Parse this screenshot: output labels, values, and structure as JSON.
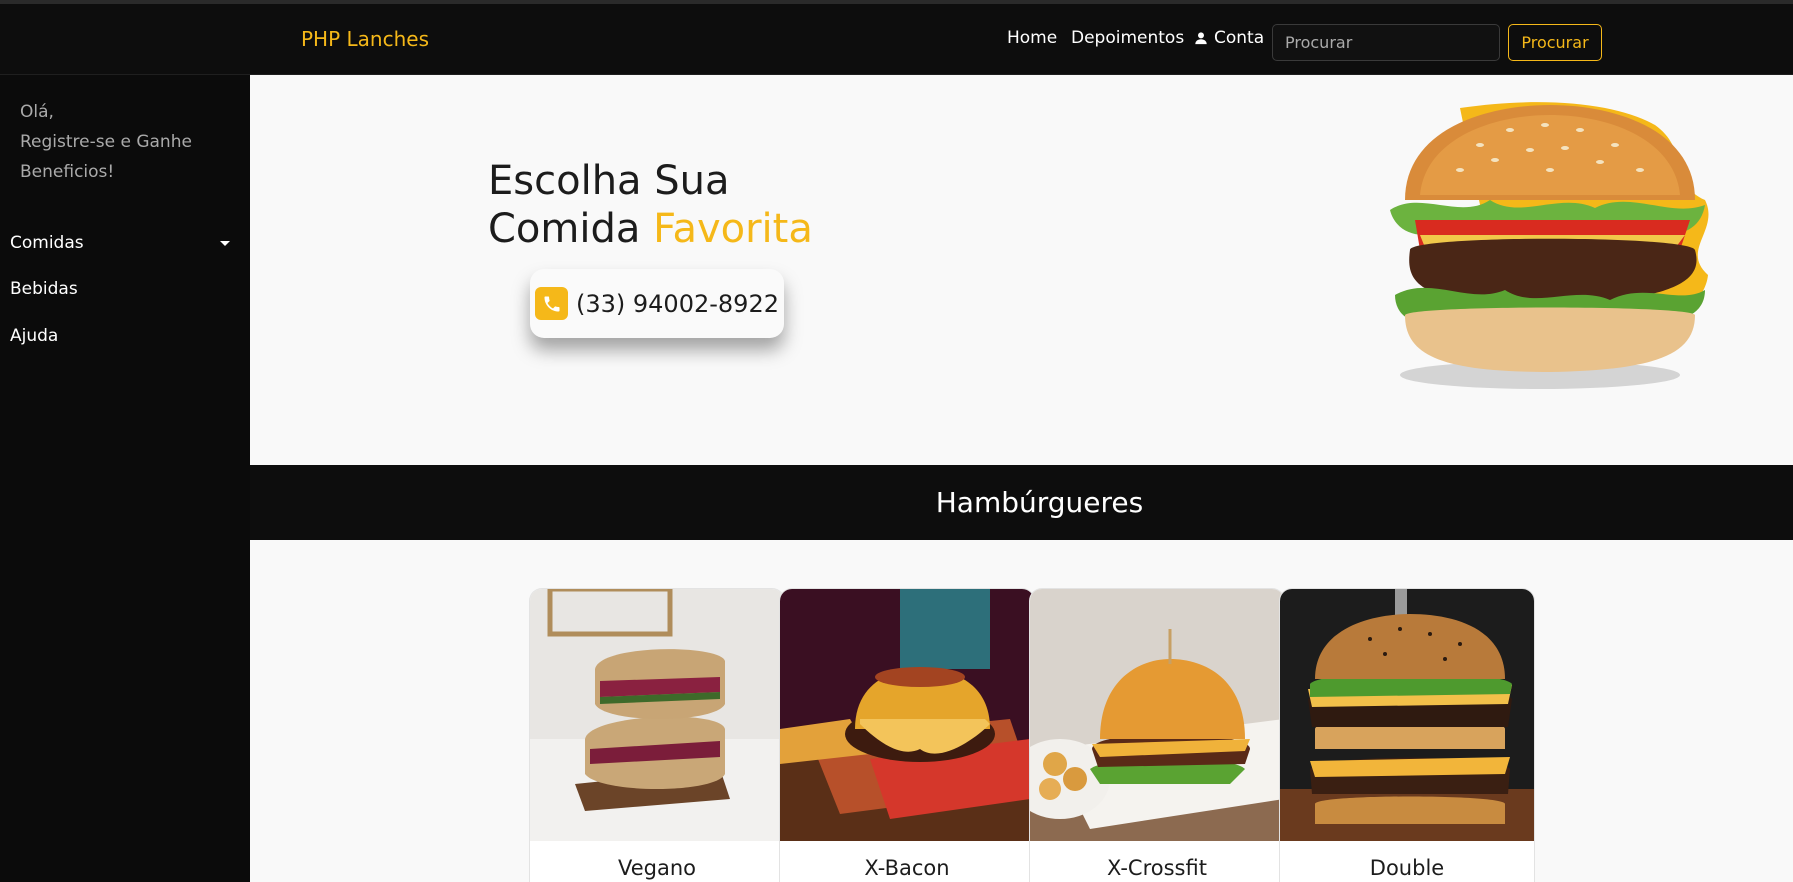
{
  "header": {
    "brand": "PHP Lanches",
    "nav": {
      "home": "Home",
      "depoimentos": "Depoimentos",
      "conta": "Conta"
    },
    "search": {
      "placeholder": "Procurar",
      "button": "Procurar"
    }
  },
  "sidebar": {
    "greeting_line1": "Olá,",
    "greeting_line2": "Registre-se e Ganhe Beneficios!",
    "items": [
      {
        "label": "Comidas",
        "has_dropdown": true
      },
      {
        "label": "Bebidas"
      },
      {
        "label": "Ajuda"
      }
    ]
  },
  "hero": {
    "title_part1": "Escolha Sua",
    "title_part2": "Comida ",
    "title_highlight": "Favorita",
    "phone": "(33) 94002-8922"
  },
  "section": {
    "title": "Hambúrgueres"
  },
  "products": [
    {
      "name": "Vegano"
    },
    {
      "name": "X-Bacon"
    },
    {
      "name": "X-Crossfit"
    },
    {
      "name": "Double"
    }
  ],
  "colors": {
    "accent": "#f5b819",
    "dark": "#0d0d0d",
    "light_bg": "#f9f9f9"
  }
}
